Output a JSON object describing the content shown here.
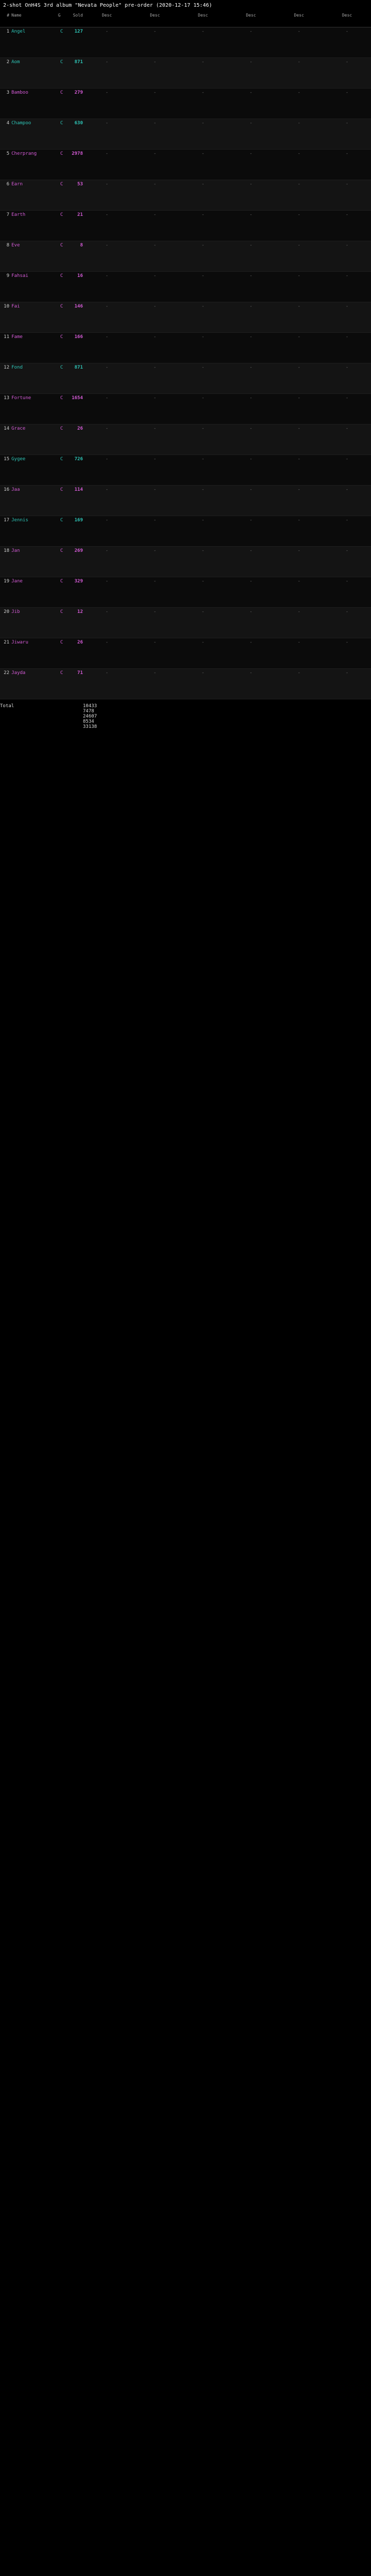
{
  "title": "2-shot OnH4S 3rd album \"Nevata People\" pre-order (2020-12-17 15:46)",
  "header": {
    "num": "#",
    "name": "Name",
    "g": "G",
    "sold": "Sold",
    "groups": [
      "Desc",
      "Desc",
      "Desc",
      "Desc",
      "Desc",
      "Desc"
    ]
  },
  "rows": [
    {
      "num": "1",
      "name": "Angel",
      "g": "C",
      "sold": "127",
      "color": "teal"
    },
    {
      "num": "2",
      "name": "Aom",
      "g": "C",
      "sold": "871",
      "color": "teal"
    },
    {
      "num": "3",
      "name": "Bamboo",
      "g": "C",
      "sold": "279",
      "color": "pink"
    },
    {
      "num": "4",
      "name": "Champoo",
      "g": "C",
      "sold": "630",
      "color": "teal"
    },
    {
      "num": "5",
      "name": "Cherprang",
      "g": "C",
      "sold": "2978",
      "color": "pink"
    },
    {
      "num": "6",
      "name": "Earn",
      "g": "C",
      "sold": "53",
      "color": "pink"
    },
    {
      "num": "7",
      "name": "Earth",
      "g": "C",
      "sold": "21",
      "color": "pink"
    },
    {
      "num": "8",
      "name": "Eve",
      "g": "C",
      "sold": "8",
      "color": "pink"
    },
    {
      "num": "9",
      "name": "Fahsai",
      "g": "C",
      "sold": "16",
      "color": "pink"
    },
    {
      "num": "10",
      "name": "Fai",
      "g": "C",
      "sold": "146",
      "color": "pink"
    },
    {
      "num": "11",
      "name": "Fame",
      "g": "C",
      "sold": "166",
      "color": "pink"
    },
    {
      "num": "12",
      "name": "Fond",
      "g": "C",
      "sold": "871",
      "color": "teal"
    },
    {
      "num": "13",
      "name": "Fortune",
      "g": "C",
      "sold": "1654",
      "color": "pink"
    },
    {
      "num": "14",
      "name": "Grace",
      "g": "C",
      "sold": "26",
      "color": "pink"
    },
    {
      "num": "15",
      "name": "Gygee",
      "g": "C",
      "sold": "726",
      "color": "teal"
    },
    {
      "num": "16",
      "name": "Jaa",
      "g": "C",
      "sold": "114",
      "color": "pink"
    },
    {
      "num": "17",
      "name": "Jennis",
      "g": "C",
      "sold": "169",
      "color": "teal"
    },
    {
      "num": "18",
      "name": "Jan",
      "g": "C",
      "sold": "269",
      "color": "pink"
    },
    {
      "num": "19",
      "name": "Jane",
      "g": "C",
      "sold": "329",
      "color": "pink"
    },
    {
      "num": "20",
      "name": "Jib",
      "g": "C",
      "sold": "12",
      "color": "pink"
    },
    {
      "num": "21",
      "name": "Jiwaru",
      "g": "C",
      "sold": "26",
      "color": "pink"
    },
    {
      "num": "22",
      "name": "Jayda",
      "g": "C",
      "sold": "71",
      "color": "pink"
    }
  ],
  "footer": {
    "label": "Total",
    "values": [
      "10433",
      "7478",
      "24607",
      "8534",
      "33138"
    ]
  }
}
